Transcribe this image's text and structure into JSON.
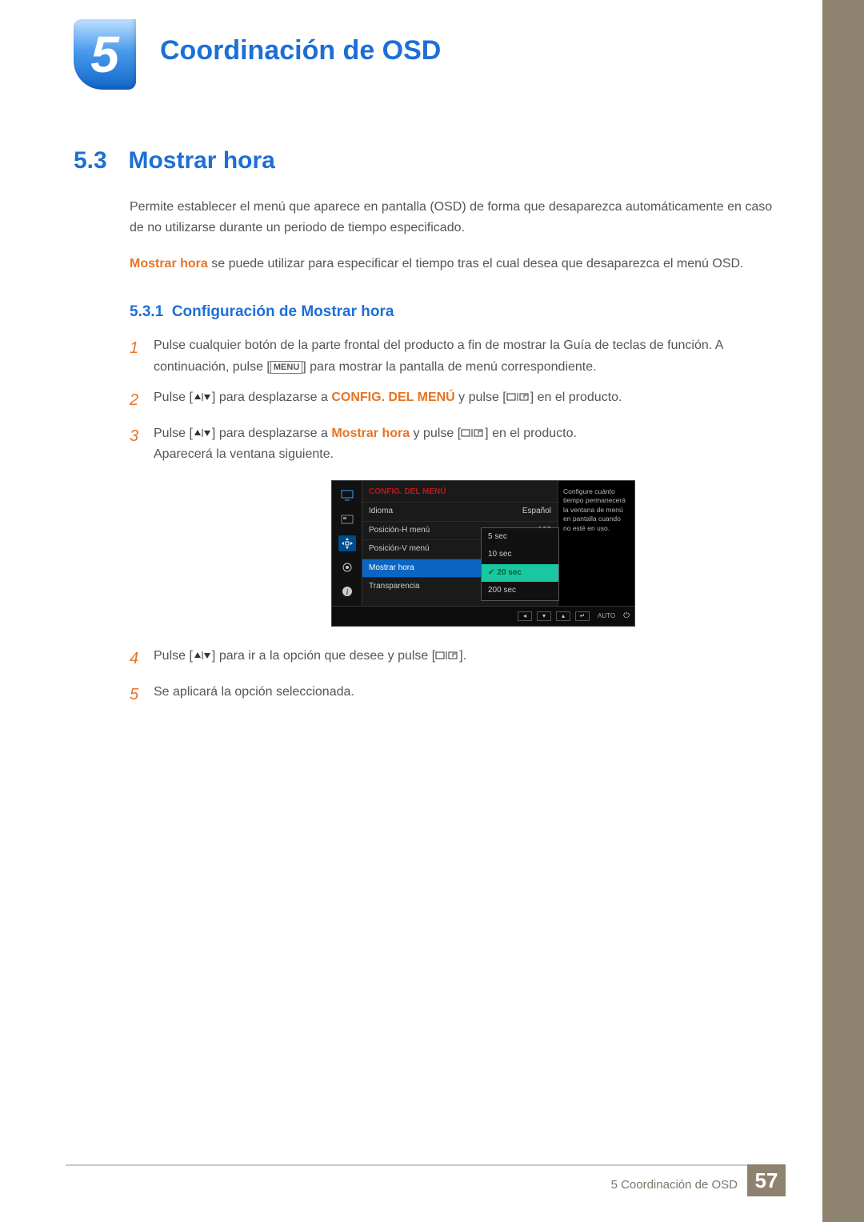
{
  "chapter": {
    "number": "5",
    "title": "Coordinación de OSD"
  },
  "section": {
    "number": "5.3",
    "title": "Mostrar hora"
  },
  "intro_para": "Permite establecer el menú que aparece en pantalla (OSD) de forma que desaparezca automáticamente en caso de no utilizarse durante un periodo de tiempo especificado.",
  "intro2_term": "Mostrar hora",
  "intro2_rest": " se puede utilizar para especificar el tiempo tras el cual desea que desaparezca el menú OSD.",
  "subsection": {
    "number": "5.3.1",
    "title": "Configuración de Mostrar hora"
  },
  "steps": {
    "s1a": "Pulse cualquier botón de la parte frontal del producto a fin de mostrar la Guía de teclas de función. A continuación, pulse [",
    "s1b": "] para mostrar la pantalla de menú correspondiente.",
    "menu_label": "MENU",
    "s2a": "Pulse [",
    "s2b": "] para desplazarse a ",
    "s2_term": "CONFIG. DEL MENÚ",
    "s2c": " y pulse [",
    "s2d": "] en el producto.",
    "s3a": "Pulse [",
    "s3b": "] para desplazarse a ",
    "s3_term": "Mostrar hora",
    "s3c": " y pulse [",
    "s3d": "] en el producto.",
    "s3_after": "Aparecerá la ventana siguiente.",
    "s4a": "Pulse [",
    "s4b": "] para ir a la opción que desee y pulse [",
    "s4c": "].",
    "s5": "Se aplicará la opción seleccionada."
  },
  "osd": {
    "header": "CONFIG. DEL MENÚ",
    "rows": {
      "idioma_l": "Idioma",
      "idioma_v": "Español",
      "posh_l": "Posición-H menú",
      "posh_v": "100",
      "posv_l": "Posición-V menú",
      "mh_l": "Mostrar hora",
      "tr_l": "Transparencia"
    },
    "options": {
      "o1": "5 sec",
      "o2": "10 sec",
      "o3": "20 sec",
      "o4": "200 sec"
    },
    "right_text": "Configure cuánto tiempo permanecerá la ventana de menú en pantalla cuando no esté en uso.",
    "auto": "AUTO"
  },
  "footer": {
    "text": "5 Coordinación de OSD",
    "page": "57"
  }
}
